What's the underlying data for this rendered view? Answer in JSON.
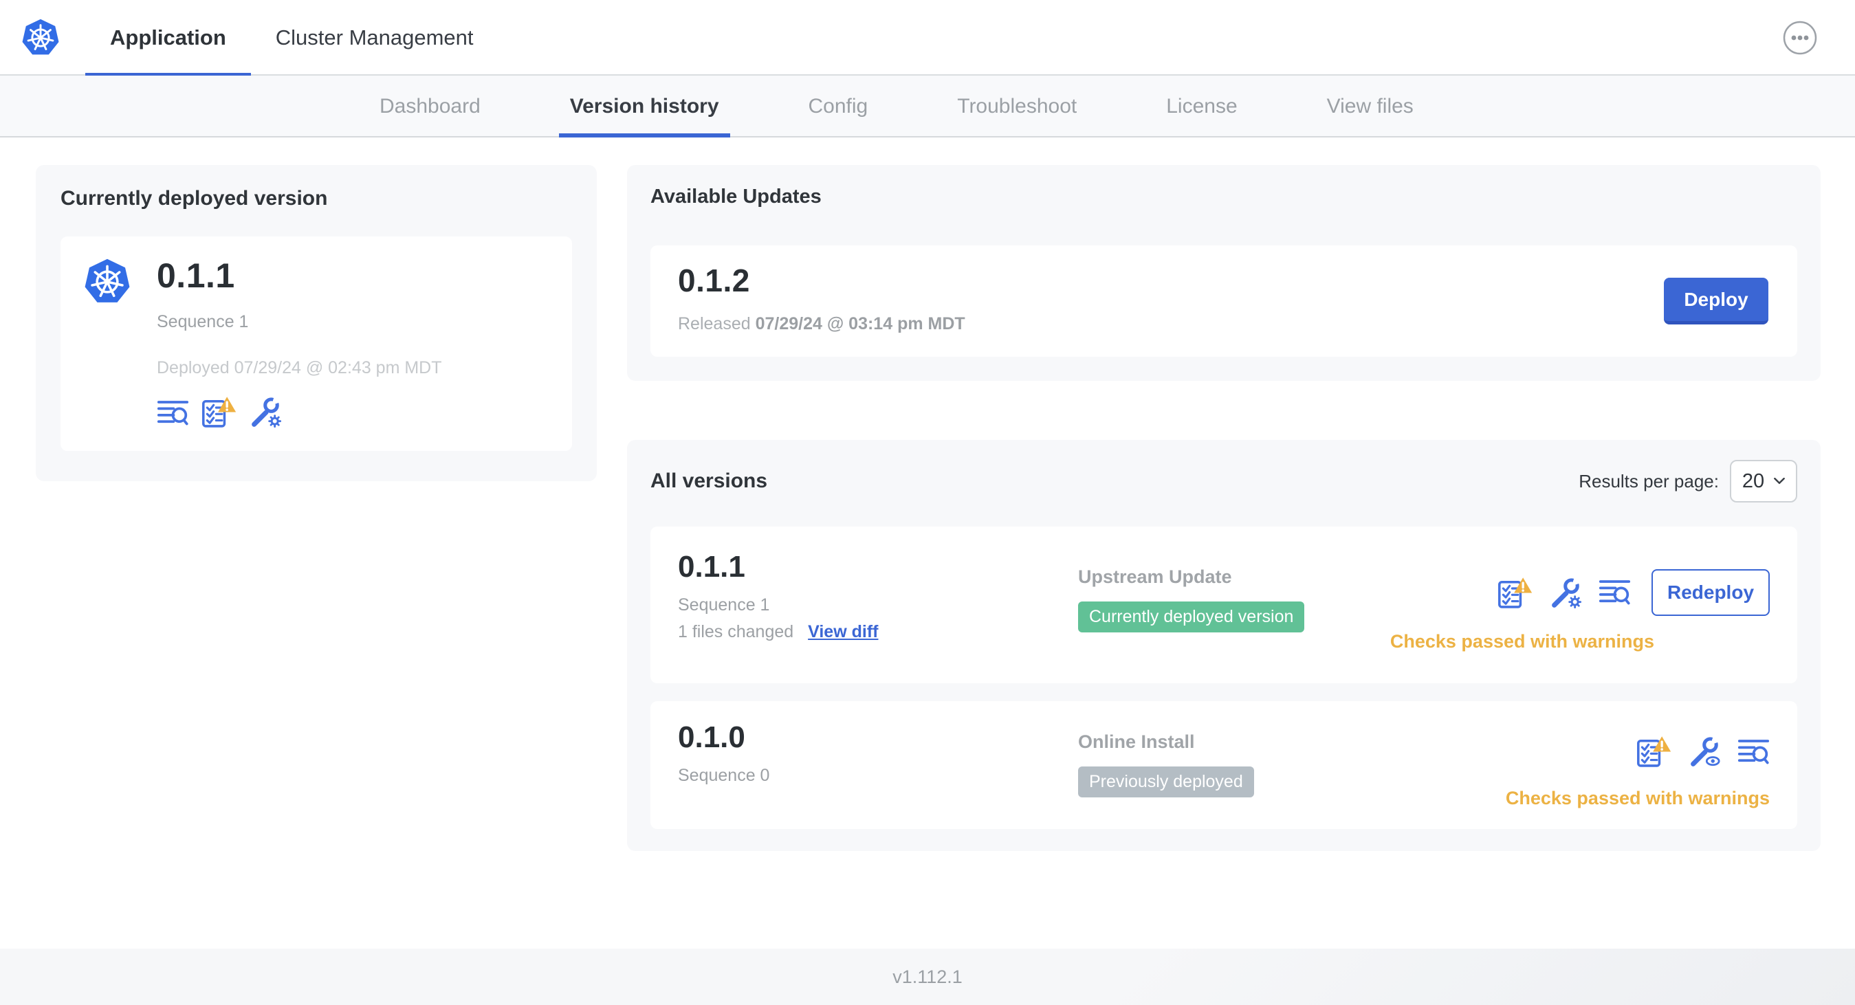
{
  "colors": {
    "accent_blue": "#3b66d4",
    "icon_blue": "#4472e2",
    "k8s_blue": "#326de6",
    "warning_amber": "#eeb041",
    "status_orange": "#ecb244",
    "badge_green": "#61c196",
    "badge_gray": "#b4bdc4",
    "card_bg": "#f7f8fa",
    "link_blue": "#3b66d4"
  },
  "header": {
    "tabs": [
      {
        "label": "Application",
        "active": true
      },
      {
        "label": "Cluster Management",
        "active": false
      }
    ],
    "menu_icon": "more-options-ellipsis"
  },
  "subnav": {
    "tabs": [
      {
        "label": "Dashboard",
        "active": false
      },
      {
        "label": "Version history",
        "active": true
      },
      {
        "label": "Config",
        "active": false
      },
      {
        "label": "Troubleshoot",
        "active": false
      },
      {
        "label": "License",
        "active": false
      },
      {
        "label": "View files",
        "active": false
      }
    ]
  },
  "current_version_card": {
    "title": "Currently deployed version",
    "version": "0.1.1",
    "sequence": "Sequence 1",
    "deployed": "Deployed 07/29/24 @ 02:43 pm MDT",
    "icons": [
      "deploy-logs-icon",
      "preflight-checks-warning-icon",
      "edit-config-icon"
    ]
  },
  "available_updates": {
    "title": "Available Updates",
    "version": "0.1.2",
    "released_prefix": "Released",
    "released_date": "07/29/24 @ 03:14 pm MDT",
    "deploy_label": "Deploy"
  },
  "all_versions": {
    "title": "All versions",
    "results_per_page_label": "Results per page:",
    "results_per_page_value": "20",
    "rows": [
      {
        "version": "0.1.1",
        "sequence": "Sequence 1",
        "files_changed": "1 files changed",
        "view_diff_label": "View diff",
        "source": "Upstream Update",
        "badge": {
          "label": "Currently deployed version",
          "type": "green"
        },
        "action_label": "Redeploy",
        "status": "Checks passed with warnings",
        "icons": [
          "preflight-checks-warning-icon",
          "edit-config-icon",
          "deploy-logs-icon"
        ]
      },
      {
        "version": "0.1.0",
        "sequence": "Sequence 0",
        "source": "Online Install",
        "badge": {
          "label": "Previously deployed",
          "type": "gray"
        },
        "status": "Checks passed with warnings",
        "icons": [
          "preflight-checks-warning-icon",
          "view-config-icon",
          "deploy-logs-icon"
        ]
      }
    ]
  },
  "footer": {
    "version": "v1.112.1"
  }
}
